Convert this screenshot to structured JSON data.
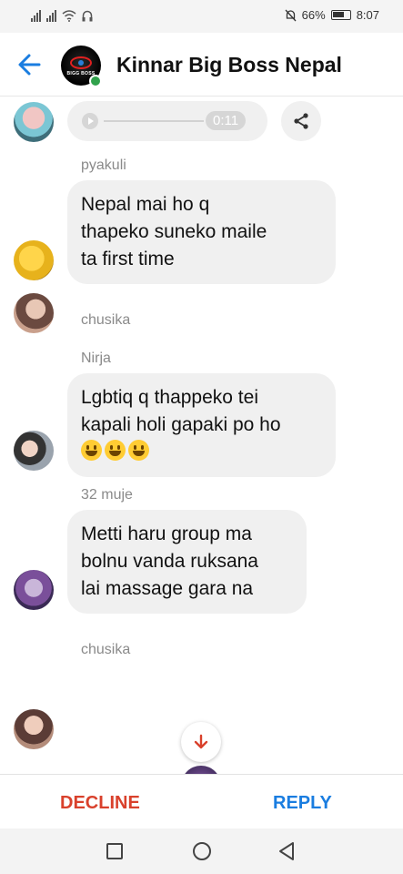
{
  "status_bar": {
    "battery_percent": "66%",
    "time": "8:07"
  },
  "header": {
    "title": "Kinnar Big Boss Nepal",
    "avatar_text": "BIGG BOSS",
    "back_icon": "arrow-left-icon"
  },
  "messages": [
    {
      "type": "audio",
      "duration": "0:11"
    },
    {
      "type": "text",
      "sender": "pyakuli",
      "text_lines": [
        "Nepal mai ho q",
        "thapeko suneko maile",
        "ta first time"
      ]
    },
    {
      "type": "seen",
      "sender": "chusika"
    },
    {
      "type": "text",
      "sender": "Nirja",
      "text_lines": [
        "Lgbtiq q thappeko tei",
        "kapali holi gapaki po ho"
      ],
      "emoji_count": 3
    },
    {
      "type": "text",
      "sender": "32 muje",
      "text_lines": [
        "Metti haru group ma",
        "bolnu vanda ruksana",
        "lai massage gara na"
      ]
    },
    {
      "type": "seen",
      "sender": "chusika"
    }
  ],
  "actions": {
    "decline": "DECLINE",
    "reply": "REPLY"
  },
  "colors": {
    "decline": "#d9412c",
    "reply": "#1a7de0",
    "accent": "#1a7de0",
    "online": "#31a24c"
  }
}
